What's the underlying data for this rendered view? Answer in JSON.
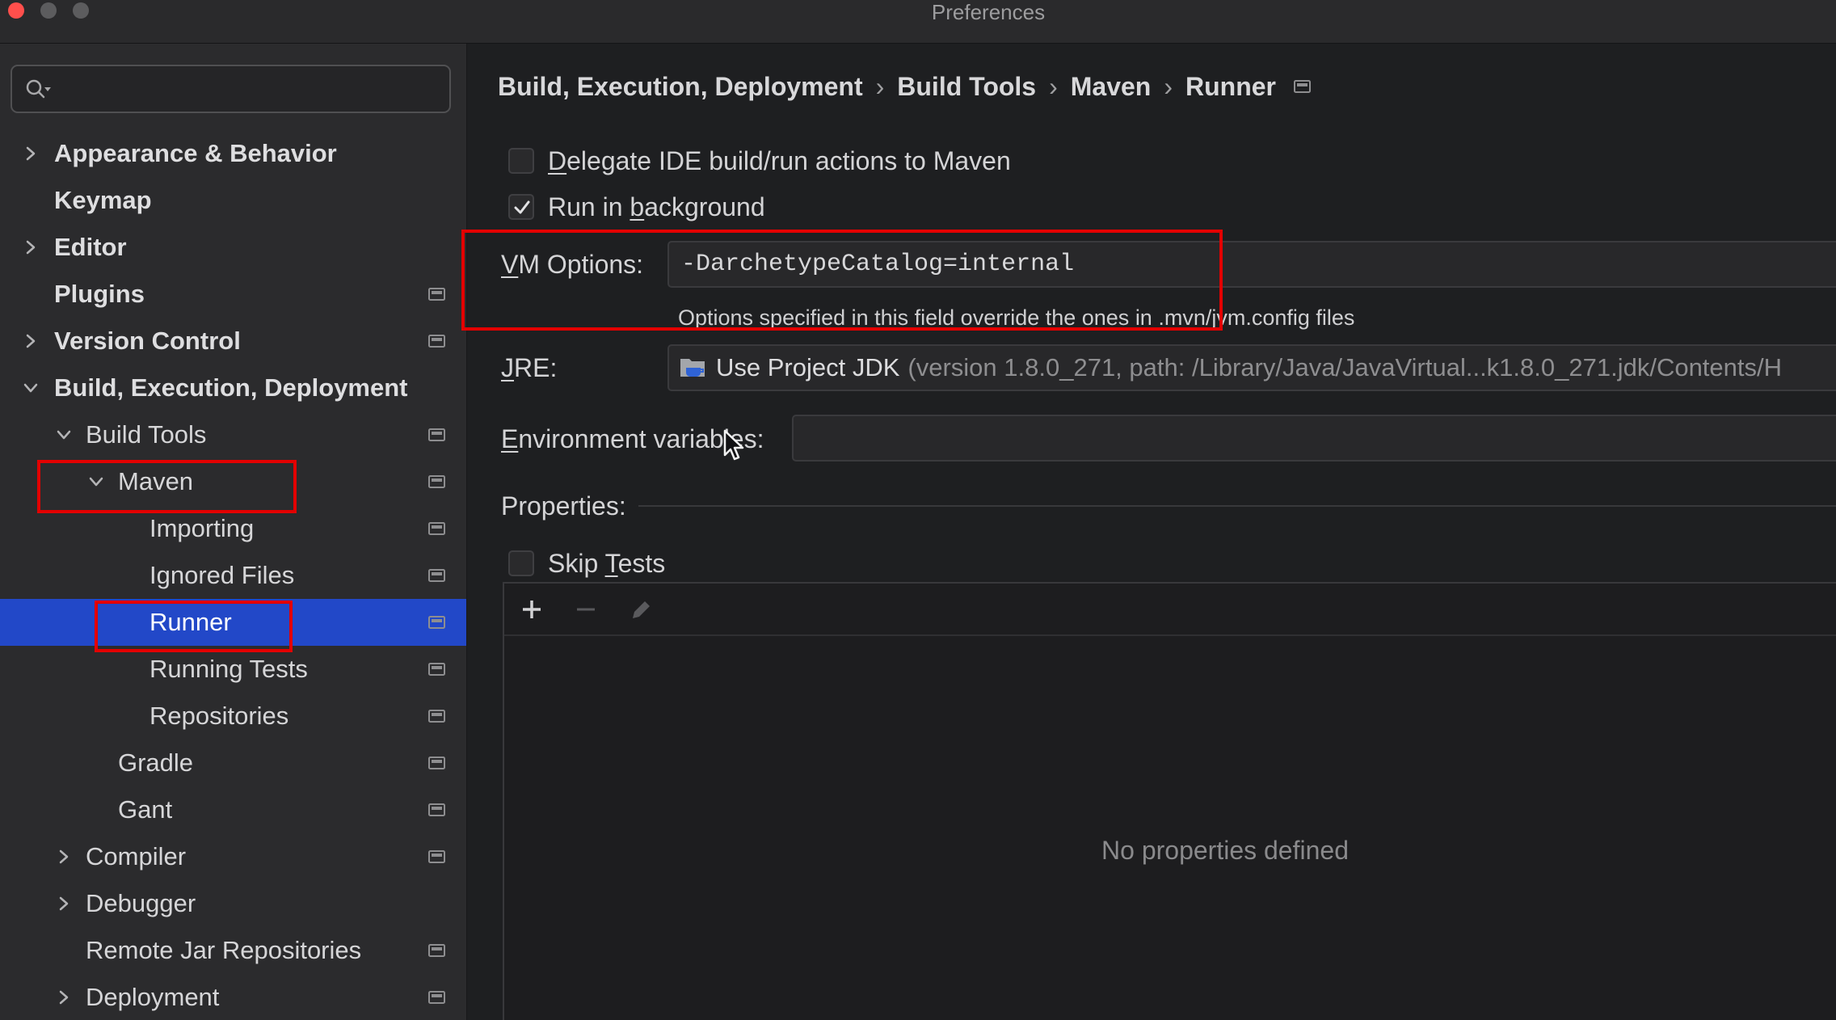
{
  "window": {
    "title": "Preferences"
  },
  "sidebar": {
    "items": [
      {
        "label": "Appearance & Behavior",
        "level": 0,
        "expander_icon": "chevron-right-icon",
        "project_icon": false
      },
      {
        "label": "Keymap",
        "level": 0,
        "expander_icon": null,
        "project_icon": false
      },
      {
        "label": "Editor",
        "level": 0,
        "expander_icon": "chevron-right-icon",
        "project_icon": false
      },
      {
        "label": "Plugins",
        "level": 0,
        "expander_icon": null,
        "project_icon": true
      },
      {
        "label": "Version Control",
        "level": 0,
        "expander_icon": "chevron-right-icon",
        "project_icon": true
      },
      {
        "label": "Build, Execution, Deployment",
        "level": 0,
        "expander_icon": "chevron-down-icon",
        "project_icon": false
      },
      {
        "label": "Build Tools",
        "level": 1,
        "expander_icon": "chevron-down-icon",
        "project_icon": true
      },
      {
        "label": "Maven",
        "level": 2,
        "expander_icon": "chevron-down-icon",
        "project_icon": true
      },
      {
        "label": "Importing",
        "level": 3,
        "expander_icon": null,
        "project_icon": true
      },
      {
        "label": "Ignored Files",
        "level": 3,
        "expander_icon": null,
        "project_icon": true
      },
      {
        "label": "Runner",
        "level": 3,
        "expander_icon": null,
        "project_icon": true,
        "selected": true
      },
      {
        "label": "Running Tests",
        "level": 3,
        "expander_icon": null,
        "project_icon": true
      },
      {
        "label": "Repositories",
        "level": 3,
        "expander_icon": null,
        "project_icon": true
      },
      {
        "label": "Gradle",
        "level": 2,
        "expander_icon": null,
        "project_icon": true
      },
      {
        "label": "Gant",
        "level": 2,
        "expander_icon": null,
        "project_icon": true
      },
      {
        "label": "Compiler",
        "level": 1,
        "expander_icon": "chevron-right-icon",
        "project_icon": true
      },
      {
        "label": "Debugger",
        "level": 1,
        "expander_icon": "chevron-right-icon",
        "project_icon": false
      },
      {
        "label": "Remote Jar Repositories",
        "level": 1,
        "expander_icon": null,
        "project_icon": true
      },
      {
        "label": "Deployment",
        "level": 1,
        "expander_icon": "chevron-right-icon",
        "project_icon": true
      }
    ]
  },
  "breadcrumb": {
    "items": [
      "Build, Execution, Deployment",
      "Build Tools",
      "Maven",
      "Runner"
    ],
    "separator": "›"
  },
  "runner": {
    "delegate": {
      "label": "Delegate IDE build/run actions to Maven",
      "mnemonic": "D",
      "checked": false
    },
    "run_in_background": {
      "label": "Run in background",
      "mnemonic": "b",
      "checked": true
    },
    "vm_options": {
      "label": "VM Options:",
      "mnemonic": "V",
      "value": "-DarchetypeCatalog=internal",
      "hint": "Options specified in this field override the ones in .mvn/jvm.config files"
    },
    "jre": {
      "label": "JRE:",
      "mnemonic": "J",
      "value": "Use Project JDK",
      "detail": "(version 1.8.0_271, path: /Library/Java/JavaVirtual...k1.8.0_271.jdk/Contents/H"
    },
    "environment_variables": {
      "label": "Environment variables:",
      "mnemonic": "E",
      "value": ""
    },
    "properties": {
      "label": "Properties:",
      "empty_text": "No properties defined"
    },
    "skip_tests": {
      "label": "Skip Tests",
      "mnemonic": "T",
      "checked": false
    }
  },
  "icons": {
    "search": "search-icon",
    "project_level": "project-level-icon",
    "jre": "folder-java-icon",
    "add": "add-icon",
    "remove": "remove-icon",
    "edit": "pencil-icon",
    "pointer": "mouse-pointer-icon"
  },
  "colors": {
    "selection": "#2248c8",
    "annotation": "#e30000",
    "close_button": "#ff4f4c",
    "inactive_button": "#5c5c5e"
  }
}
